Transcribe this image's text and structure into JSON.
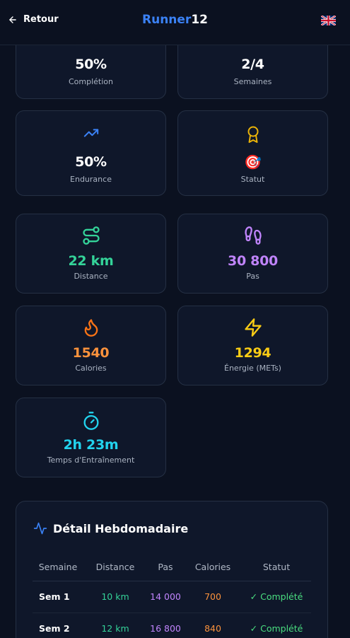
{
  "header": {
    "back_label": "Retour",
    "brand_main": "Runner",
    "brand_num": "12"
  },
  "stats_top": [
    {
      "value": "50%",
      "label": "Complétion"
    },
    {
      "value": "2/4",
      "label": "Semaines"
    }
  ],
  "stats_mid": [
    {
      "value": "50%",
      "label": "Endurance",
      "color": "#ffffff"
    },
    {
      "value": "🎯",
      "label": "Statut"
    }
  ],
  "stats": [
    {
      "value": "22 km",
      "label": "Distance",
      "color": "#34d399"
    },
    {
      "value": "30 800",
      "label": "Pas",
      "color": "#c084fc"
    },
    {
      "value": "1540",
      "label": "Calories",
      "color": "#fb923c"
    },
    {
      "value": "1294",
      "label": "Énergie (METs)",
      "color": "#facc15"
    },
    {
      "value": "2h 23m",
      "label": "Temps d'Entraînement",
      "color": "#22d3ee"
    }
  ],
  "detail": {
    "title": "Détail Hebdomadaire",
    "columns": [
      "Semaine",
      "Distance",
      "Pas",
      "Calories",
      "Statut"
    ],
    "rows": [
      {
        "week": "Sem 1",
        "distance": "10 km",
        "steps": "14 000",
        "calories": "700",
        "status": "✓ Complété"
      },
      {
        "week": "Sem 2",
        "distance": "12 km",
        "steps": "16 800",
        "calories": "840",
        "status": "✓ Complété"
      }
    ]
  },
  "icons": [
    "arrow-left-icon",
    "uk-flag-icon",
    "trending-up-icon",
    "award-icon",
    "route-icon",
    "footprints-icon",
    "flame-icon",
    "zap-icon",
    "timer-icon",
    "activity-icon"
  ]
}
